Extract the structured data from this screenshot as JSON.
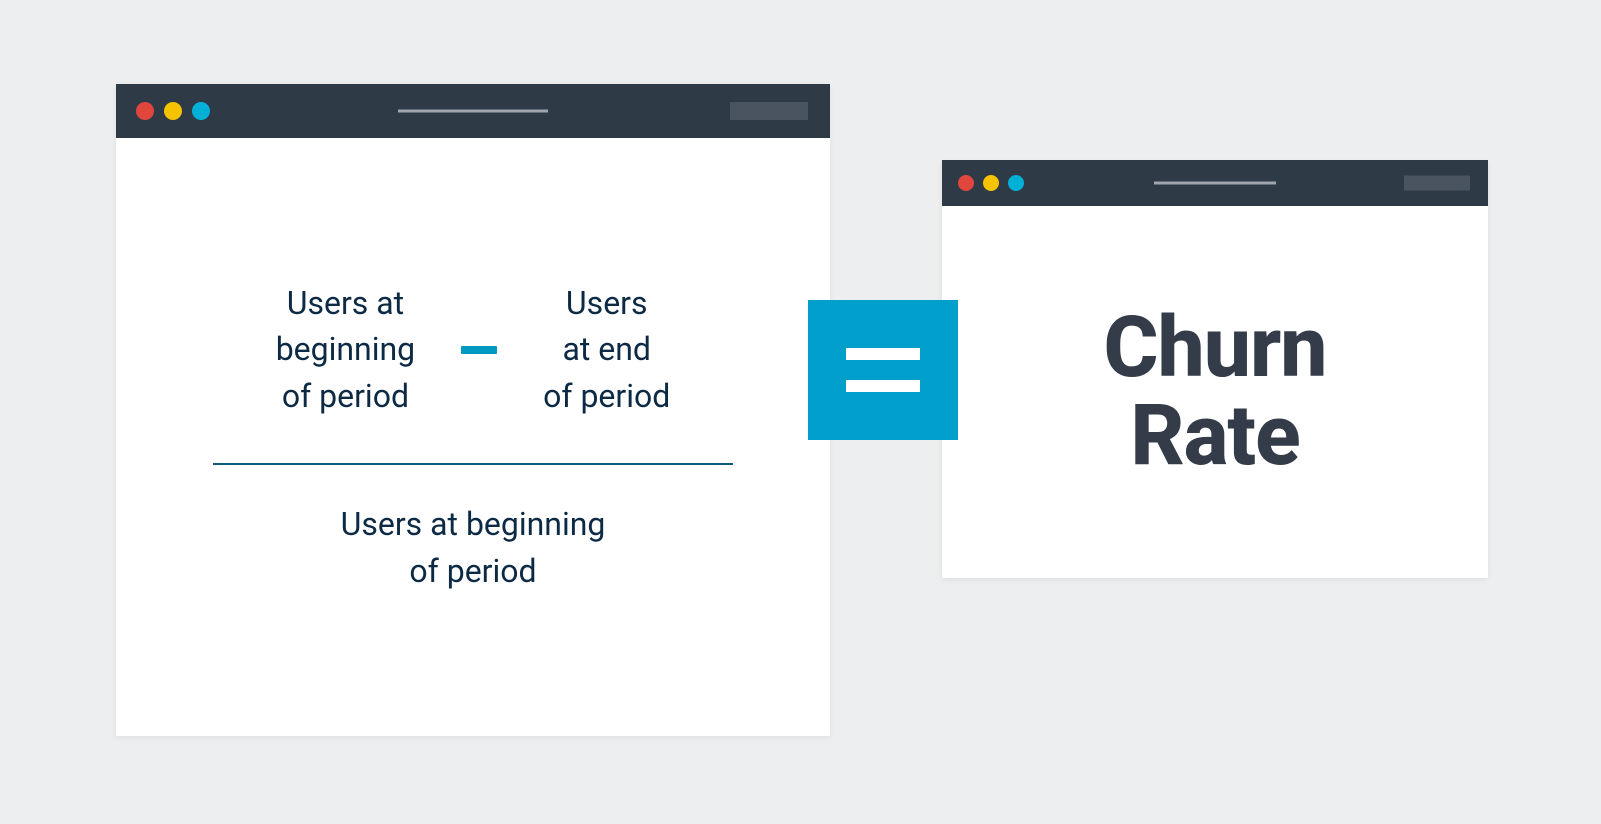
{
  "formula": {
    "numerator_left_line1": "Users at",
    "numerator_left_line2": "beginning",
    "numerator_left_line3": "of period",
    "numerator_right_line1": "Users",
    "numerator_right_line2": "at end",
    "numerator_right_line3": "of period",
    "denominator_line1": "Users at beginning",
    "denominator_line2": "of period"
  },
  "result": {
    "line1": "Churn",
    "line2": "Rate"
  },
  "colors": {
    "bg": "#edeeef",
    "window_bg": "#ffffff",
    "titlebar": "#2f3a47",
    "dot_red": "#e0463b",
    "dot_yellow": "#f6c301",
    "dot_cyan": "#00b0d7",
    "accent_teal": "#009fcc",
    "text_dark": "#0d2a44",
    "result_text": "#343c49"
  }
}
